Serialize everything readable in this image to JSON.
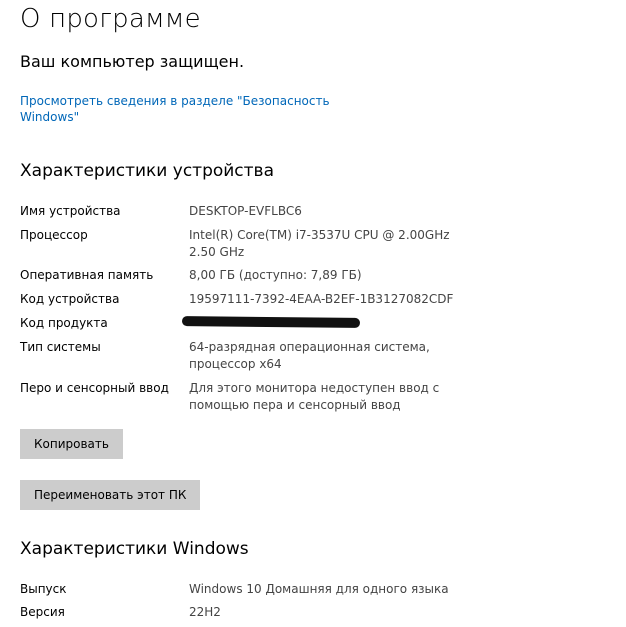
{
  "page": {
    "title": "О программе"
  },
  "protection": {
    "status": "Ваш компьютер защищен.",
    "link": "Просмотреть сведения в разделе \"Безопасность Windows\""
  },
  "device": {
    "heading": "Характеристики устройства",
    "specs": [
      {
        "label": "Имя устройства",
        "value": "DESKTOP-EVFLBC6"
      },
      {
        "label": "Процессор",
        "value": "Intel(R) Core(TM) i7-3537U CPU @ 2.00GHz 2.50 GHz"
      },
      {
        "label": "Оперативная память",
        "value": "8,00 ГБ (доступно: 7,89 ГБ)"
      },
      {
        "label": "Код устройства",
        "value": "19597111-7392-4EAA-B2EF-1B3127082CDF"
      },
      {
        "label": "Код продукта",
        "value": ""
      },
      {
        "label": "Тип системы",
        "value": "64-разрядная операционная система, процессор x64"
      },
      {
        "label": "Перо и сенсорный ввод",
        "value": "Для этого монитора недоступен ввод с помощью пера и сенсорный ввод"
      }
    ],
    "copy_button": "Копировать",
    "rename_button": "Переименовать этот ПК"
  },
  "windows": {
    "heading": "Характеристики Windows",
    "specs": [
      {
        "label": "Выпуск",
        "value": "Windows 10 Домашняя для одного языка"
      },
      {
        "label": "Версия",
        "value": "22H2"
      }
    ]
  }
}
